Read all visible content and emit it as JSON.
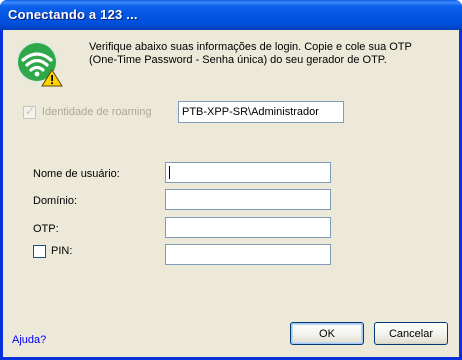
{
  "window": {
    "title": "Conectando a 123 ..."
  },
  "intro": {
    "text": "Verifique abaixo suas informações de login. Copie e cole sua OTP (One-Time Password - Senha única) do seu gerador de OTP."
  },
  "roaming": {
    "label": "Identidade de roaming",
    "checked": true,
    "enabled": false,
    "value": "PTB-XPP-SR\\Administrador"
  },
  "fields": {
    "username_label": "Nome de usuário:",
    "username_value": "",
    "domain_label": "Domínio:",
    "domain_value": "",
    "otp_label": "OTP:",
    "otp_value": "",
    "pin_label": "PIN:",
    "pin_checked": false,
    "pin_value": ""
  },
  "footer": {
    "help_label": "Ajuda?",
    "ok_label": "OK",
    "cancel_label": "Cancelar"
  },
  "icons": {
    "app": "wireless-warning-icon"
  },
  "colors": {
    "titlebar": "#0356e2",
    "client_bg": "#ece9d8",
    "icon_green": "#2fa84a",
    "link": "#0000ff"
  }
}
